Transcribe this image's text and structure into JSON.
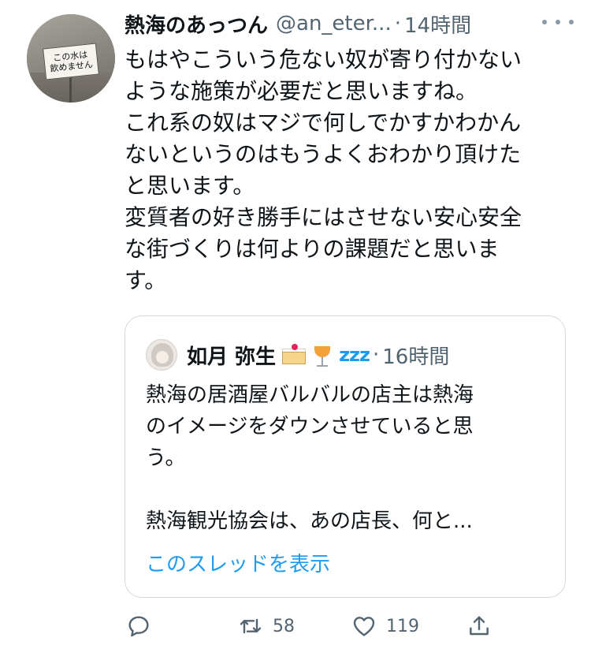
{
  "tweet": {
    "display_name": "熱海のあっつん",
    "handle": "@an_eter...",
    "separator": "·",
    "time": "14時間",
    "avatar_sign": "この水は\n飲めません",
    "text_lines": [
      "もはやこういう危ない奴が寄り付かない",
      "ような施策が必要だと思いますね。",
      "これ系の奴はマジで何しでかすかわかん",
      "ないというのはもうよくおわかり頂けた",
      "と思います。",
      "変質者の好き勝手にはさせない安心安全",
      "な街づくりは何よりの課題だと思いま",
      "す。"
    ]
  },
  "quote": {
    "display_name": "如月 弥生",
    "zzz": "zzz",
    "separator": "·",
    "time": "16時間",
    "text_lines": [
      "熱海の居酒屋バルバルの店主は熱海",
      "のイメージをダウンさせていると思",
      "う。",
      "",
      "熱海観光協会は、あの店長、何と..."
    ],
    "show_thread": "このスレッドを表示"
  },
  "actions": {
    "reply_count": "",
    "retweet_count": "58",
    "like_count": "119"
  },
  "icons": {
    "more": "more-icon",
    "reply": "reply-icon",
    "retweet": "retweet-icon",
    "like": "like-icon",
    "share": "share-icon"
  },
  "colors": {
    "text": "#0f1419",
    "secondary": "#536471",
    "link": "#1d9bf0",
    "border": "#cfd9de"
  }
}
